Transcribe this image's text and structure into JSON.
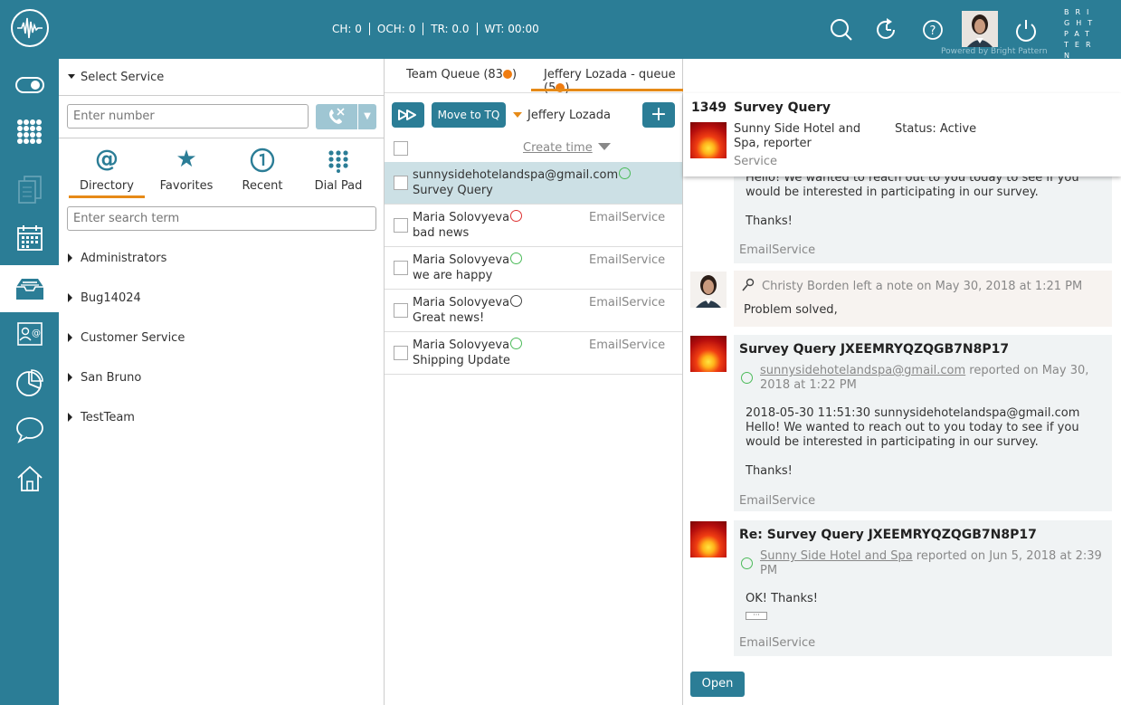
{
  "topbar": {
    "counters": [
      "CH: 0",
      "OCH: 0",
      "TR: 0.0",
      "WT: 00:00"
    ],
    "brand": "BRIGHTPATTERN",
    "powered": "Powered by Bright Pattern",
    "icons": [
      "search-icon",
      "refresh-icon",
      "help-icon",
      "user-avatar",
      "power-icon"
    ]
  },
  "leftnav": {
    "icons": [
      "toggle-icon",
      "dialpad-icon",
      "documents-icon",
      "calendar-icon",
      "inbox-icon",
      "contact-card-icon",
      "pie-chart-icon",
      "chat-icon",
      "home-icon"
    ],
    "active": "inbox-icon",
    "accent": "#2b7d96"
  },
  "directory": {
    "select_service": "Select Service",
    "number_placeholder": "Enter number",
    "search_placeholder": "Enter search term",
    "tabs": [
      {
        "label": "Directory",
        "icon": "at-icon"
      },
      {
        "label": "Favorites",
        "icon": "star-icon"
      },
      {
        "label": "Recent",
        "icon": "recent-icon"
      },
      {
        "label": "Dial Pad",
        "icon": "dialpad-icon"
      }
    ],
    "active_tab": "Directory",
    "groups": [
      "Administrators",
      "Bug14024",
      "Customer Service",
      "San Bruno",
      "TestTeam"
    ]
  },
  "queue": {
    "tabs": [
      {
        "label": "Team Queue (83",
        "close": ")"
      },
      {
        "label": "Jeffery Lozada - queue (5",
        "close": ")"
      }
    ],
    "move_to_tq": "Move to TQ",
    "assignee": "Jeffery Lozada",
    "sort_label": "Create time",
    "rows": [
      {
        "from": "sunnysidehotelandspa@gmail.com",
        "subject": "Survey Query",
        "service": "",
        "sentiment": "happy",
        "selected": true
      },
      {
        "from": "Maria Solovyeva",
        "subject": "bad news",
        "service": "EmailService",
        "sentiment": "sad",
        "selected": false
      },
      {
        "from": "Maria Solovyeva",
        "subject": "we are happy",
        "service": "EmailService",
        "sentiment": "happy",
        "selected": false
      },
      {
        "from": "Maria Solovyeva",
        "subject": "Great news!",
        "service": "EmailService",
        "sentiment": "neutral",
        "selected": false
      },
      {
        "from": "Maria Solovyeva",
        "subject": "Shipping Update",
        "service": "EmailService",
        "sentiment": "happy",
        "selected": false
      }
    ]
  },
  "detail": {
    "case_id": "1349",
    "case_title": "Survey Query",
    "contact": "Sunny Side Hotel and Spa, reporter",
    "service": "Service",
    "status": "Status: Active",
    "open_label": "Open",
    "messages": [
      {
        "kind": "email-partial",
        "body_lines": [
          "Hello! We wanted to reach out to you today to see if you",
          "would be interested in participating in our survey.",
          "",
          "Thanks!"
        ],
        "service": "EmailService"
      },
      {
        "kind": "note",
        "meta": "Christy Borden left a note on May 30, 2018 at 1:21 PM",
        "body": "Problem solved,"
      },
      {
        "kind": "email",
        "title": "Survey Query JXEEMRYQZQGB7N8P17",
        "meta_link": "sunnysidehotelandspa@gmail.com",
        "meta_rest": " reported on May 30, 2018 at 1:22 PM",
        "body_lines": [
          "2018-05-30 11:51:30 sunnysidehotelandspa@gmail.com",
          "Hello! We wanted to reach out to you today to see if you",
          "would be interested in participating in our survey.",
          "",
          "Thanks!"
        ],
        "service": "EmailService"
      },
      {
        "kind": "email",
        "title": "Re: Survey Query JXEEMRYQZQGB7N8P17",
        "meta_link": "Sunny Side Hotel and Spa",
        "meta_rest": " reported on Jun 5, 2018 at 2:39 PM",
        "body_lines": [
          "OK! Thanks!"
        ],
        "service": "EmailService"
      }
    ]
  },
  "colors": {
    "accent": "#2b7d96",
    "orange": "#e68a17",
    "selected_row": "#cce0e5"
  }
}
